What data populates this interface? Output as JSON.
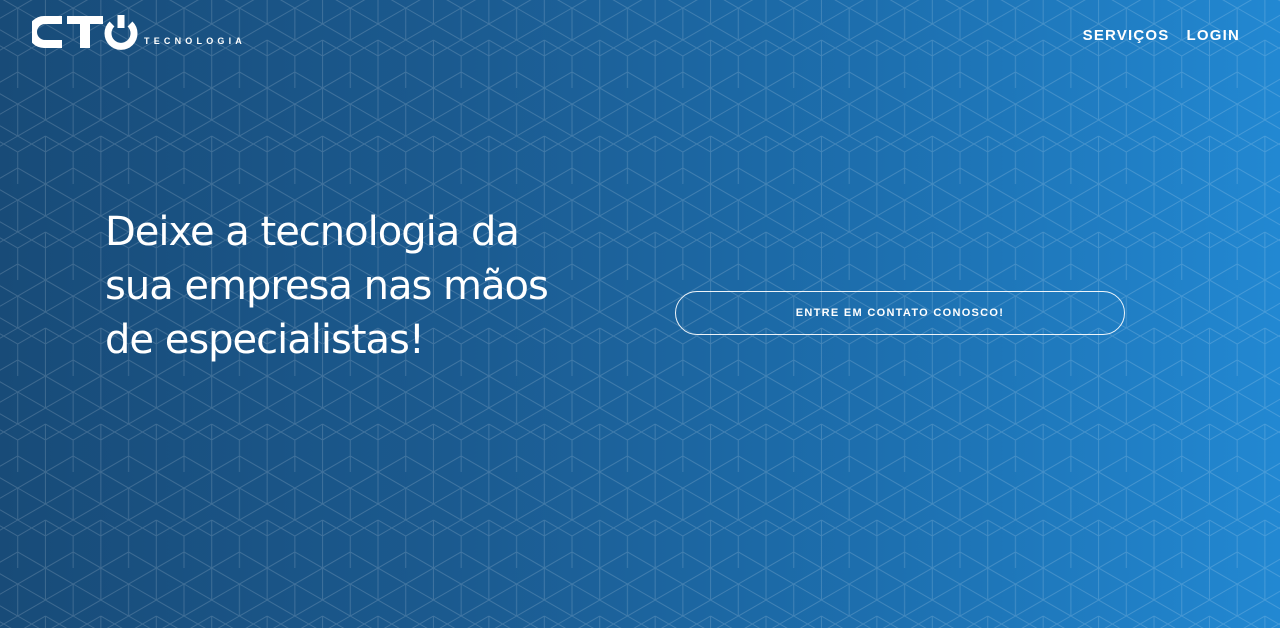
{
  "brand": {
    "logo_text": "CTO",
    "tagline": "TECNOLOGIA"
  },
  "nav": {
    "items": [
      {
        "label": "SERVIÇOS"
      },
      {
        "label": "LOGIN"
      }
    ]
  },
  "hero": {
    "headline_lines": [
      "Deixe a tecnologia da",
      "sua empresa nas mãos",
      "de especialistas!"
    ],
    "cta_label": "ENTRE EM CONTATO CONOSCO!"
  },
  "colors": {
    "gradient_left": "#184b78",
    "gradient_right": "#2288d2",
    "text": "#ffffff",
    "pattern_line": "#ffffff"
  }
}
